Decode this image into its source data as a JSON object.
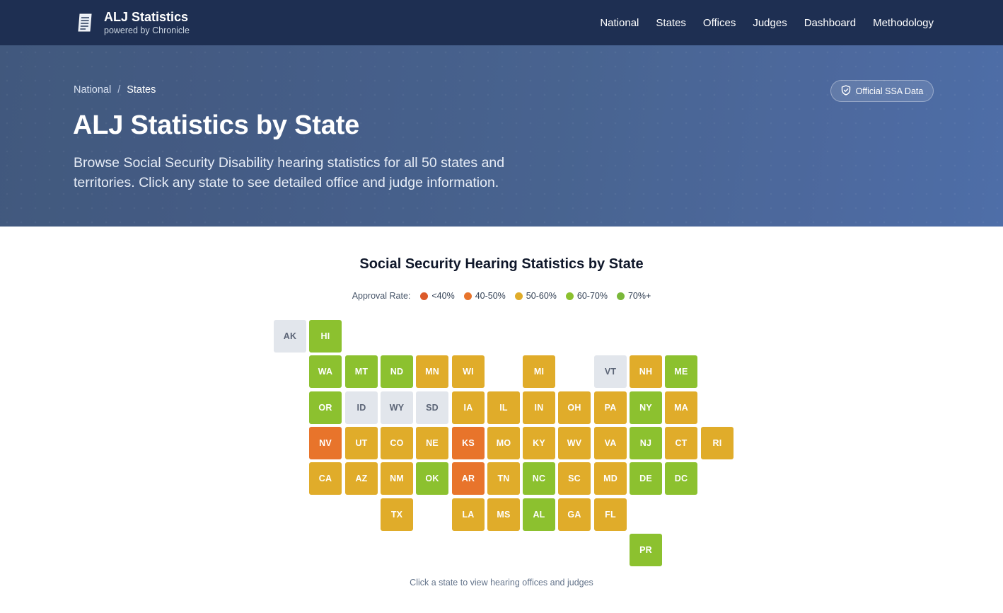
{
  "brand": {
    "title": "ALJ Statistics",
    "subtitle": "powered by Chronicle",
    "icon": "document-icon"
  },
  "nav": [
    "National",
    "States",
    "Offices",
    "Judges",
    "Dashboard",
    "Methodology"
  ],
  "breadcrumb": {
    "root": "National",
    "separator": "/",
    "current": "States"
  },
  "badge": {
    "label": "Official SSA Data",
    "icon": "shield-check-icon"
  },
  "hero": {
    "title": "ALJ Statistics by State",
    "description": "Browse Social Security Disability hearing statistics for all 50 states and territories. Click any state to see detailed office and judge information."
  },
  "map": {
    "title": "Social Security Hearing Statistics by State",
    "legend_label": "Approval Rate:",
    "legend": [
      {
        "label": "<40%",
        "color": "#dc5a2a"
      },
      {
        "label": "40-50%",
        "color": "#e8742b"
      },
      {
        "label": "50-60%",
        "color": "#e0ac2a"
      },
      {
        "label": "60-70%",
        "color": "#8cc12f"
      },
      {
        "label": "70%+",
        "color": "#7ab83a"
      }
    ],
    "nodata_color": "#e2e6ec",
    "caption": "Click a state to view hearing offices and judges",
    "tiles": [
      {
        "code": "AK",
        "row": 0,
        "col": 0,
        "band": "nodata"
      },
      {
        "code": "HI",
        "row": 0,
        "col": 1,
        "band": "60-70%"
      },
      {
        "code": "WA",
        "row": 1,
        "col": 1,
        "band": "60-70%"
      },
      {
        "code": "MT",
        "row": 1,
        "col": 2,
        "band": "60-70%"
      },
      {
        "code": "ND",
        "row": 1,
        "col": 3,
        "band": "60-70%"
      },
      {
        "code": "MN",
        "row": 1,
        "col": 4,
        "band": "50-60%"
      },
      {
        "code": "WI",
        "row": 1,
        "col": 5,
        "band": "50-60%"
      },
      {
        "code": "MI",
        "row": 1,
        "col": 7,
        "band": "50-60%"
      },
      {
        "code": "VT",
        "row": 1,
        "col": 9,
        "band": "nodata"
      },
      {
        "code": "NH",
        "row": 1,
        "col": 10,
        "band": "50-60%"
      },
      {
        "code": "ME",
        "row": 1,
        "col": 11,
        "band": "60-70%"
      },
      {
        "code": "OR",
        "row": 2,
        "col": 1,
        "band": "60-70%"
      },
      {
        "code": "ID",
        "row": 2,
        "col": 2,
        "band": "nodata"
      },
      {
        "code": "WY",
        "row": 2,
        "col": 3,
        "band": "nodata"
      },
      {
        "code": "SD",
        "row": 2,
        "col": 4,
        "band": "nodata"
      },
      {
        "code": "IA",
        "row": 2,
        "col": 5,
        "band": "50-60%"
      },
      {
        "code": "IL",
        "row": 2,
        "col": 6,
        "band": "50-60%"
      },
      {
        "code": "IN",
        "row": 2,
        "col": 7,
        "band": "50-60%"
      },
      {
        "code": "OH",
        "row": 2,
        "col": 8,
        "band": "50-60%"
      },
      {
        "code": "PA",
        "row": 2,
        "col": 9,
        "band": "50-60%"
      },
      {
        "code": "NY",
        "row": 2,
        "col": 10,
        "band": "60-70%"
      },
      {
        "code": "MA",
        "row": 2,
        "col": 11,
        "band": "50-60%"
      },
      {
        "code": "NV",
        "row": 3,
        "col": 1,
        "band": "40-50%"
      },
      {
        "code": "UT",
        "row": 3,
        "col": 2,
        "band": "50-60%"
      },
      {
        "code": "CO",
        "row": 3,
        "col": 3,
        "band": "50-60%"
      },
      {
        "code": "NE",
        "row": 3,
        "col": 4,
        "band": "50-60%"
      },
      {
        "code": "KS",
        "row": 3,
        "col": 5,
        "band": "40-50%"
      },
      {
        "code": "MO",
        "row": 3,
        "col": 6,
        "band": "50-60%"
      },
      {
        "code": "KY",
        "row": 3,
        "col": 7,
        "band": "50-60%"
      },
      {
        "code": "WV",
        "row": 3,
        "col": 8,
        "band": "50-60%"
      },
      {
        "code": "VA",
        "row": 3,
        "col": 9,
        "band": "50-60%"
      },
      {
        "code": "NJ",
        "row": 3,
        "col": 10,
        "band": "60-70%"
      },
      {
        "code": "CT",
        "row": 3,
        "col": 11,
        "band": "50-60%"
      },
      {
        "code": "RI",
        "row": 3,
        "col": 12,
        "band": "50-60%"
      },
      {
        "code": "CA",
        "row": 4,
        "col": 1,
        "band": "50-60%"
      },
      {
        "code": "AZ",
        "row": 4,
        "col": 2,
        "band": "50-60%"
      },
      {
        "code": "NM",
        "row": 4,
        "col": 3,
        "band": "50-60%"
      },
      {
        "code": "OK",
        "row": 4,
        "col": 4,
        "band": "60-70%"
      },
      {
        "code": "AR",
        "row": 4,
        "col": 5,
        "band": "40-50%"
      },
      {
        "code": "TN",
        "row": 4,
        "col": 6,
        "band": "50-60%"
      },
      {
        "code": "NC",
        "row": 4,
        "col": 7,
        "band": "60-70%"
      },
      {
        "code": "SC",
        "row": 4,
        "col": 8,
        "band": "50-60%"
      },
      {
        "code": "MD",
        "row": 4,
        "col": 9,
        "band": "50-60%"
      },
      {
        "code": "DE",
        "row": 4,
        "col": 10,
        "band": "60-70%"
      },
      {
        "code": "DC",
        "row": 4,
        "col": 11,
        "band": "60-70%"
      },
      {
        "code": "TX",
        "row": 5,
        "col": 3,
        "band": "50-60%"
      },
      {
        "code": "LA",
        "row": 5,
        "col": 5,
        "band": "50-60%"
      },
      {
        "code": "MS",
        "row": 5,
        "col": 6,
        "band": "50-60%"
      },
      {
        "code": "AL",
        "row": 5,
        "col": 7,
        "band": "60-70%"
      },
      {
        "code": "GA",
        "row": 5,
        "col": 8,
        "band": "50-60%"
      },
      {
        "code": "FL",
        "row": 5,
        "col": 9,
        "band": "50-60%"
      },
      {
        "code": "PR",
        "row": 6,
        "col": 10,
        "band": "60-70%"
      }
    ]
  }
}
